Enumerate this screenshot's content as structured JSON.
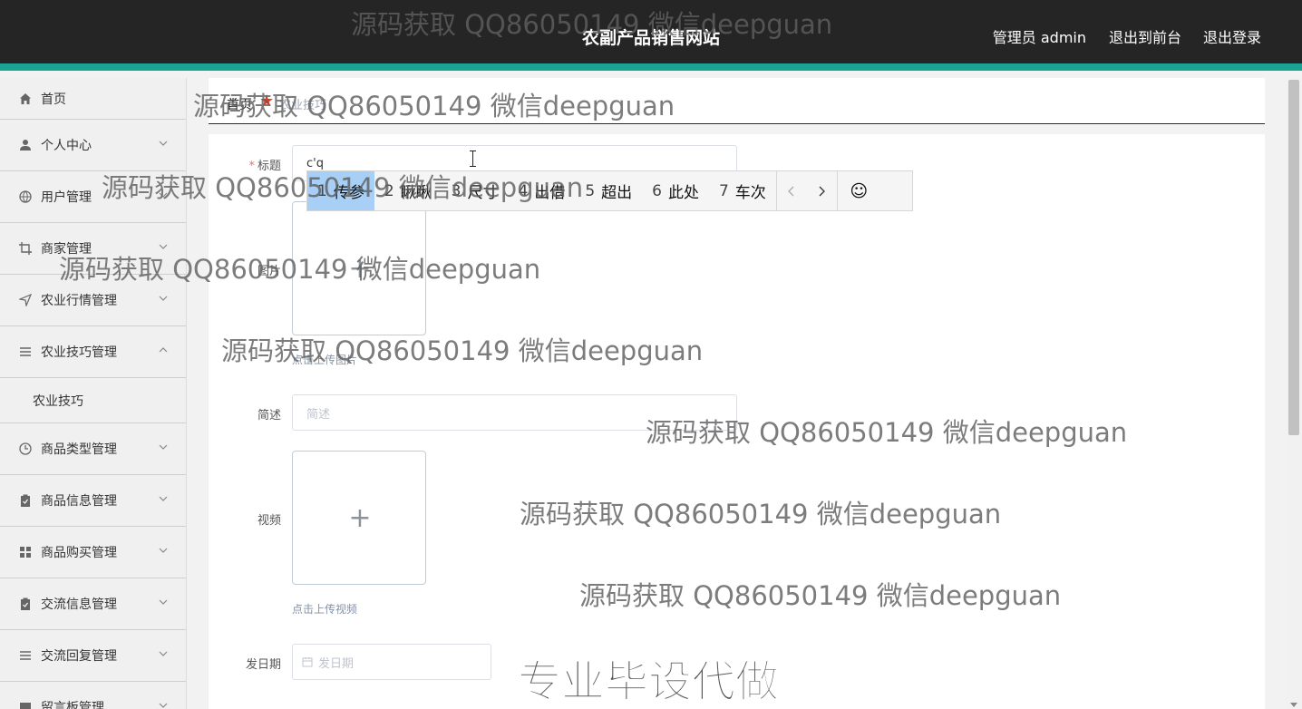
{
  "header": {
    "site_title": "农副产品销售网站",
    "admin_label": "管理员 admin",
    "to_front": "退出到前台",
    "logout": "退出登录"
  },
  "sidebar": {
    "items": [
      {
        "label": "首页",
        "icon": "home-icon"
      },
      {
        "label": "个人中心",
        "icon": "user-icon"
      },
      {
        "label": "用户管理",
        "icon": "globe-icon"
      },
      {
        "label": "商家管理",
        "icon": "crop-icon"
      },
      {
        "label": "农业行情管理",
        "icon": "send-icon"
      },
      {
        "label": "农业技巧管理",
        "icon": "menu-icon"
      },
      {
        "label": "农业技巧",
        "icon": ""
      },
      {
        "label": "商品类型管理",
        "icon": "clock-icon"
      },
      {
        "label": "商品信息管理",
        "icon": "clipboard-icon"
      },
      {
        "label": "商品购买管理",
        "icon": "grid-icon"
      },
      {
        "label": "交流信息管理",
        "icon": "checklist-icon"
      },
      {
        "label": "交流回复管理",
        "icon": "list-icon"
      },
      {
        "label": "留言板管理",
        "icon": "message-icon"
      }
    ]
  },
  "breadcrumb": {
    "home": "首页",
    "current": "农业技巧"
  },
  "form": {
    "title_label": "标题",
    "title_value": "c'q",
    "image_label": "图片",
    "image_hint": "点击上传图片",
    "summary_label": "简述",
    "summary_placeholder": "简述",
    "video_label": "视频",
    "video_hint": "点击上传视频",
    "date_label": "发日期",
    "date_placeholder": "发日期"
  },
  "ime": {
    "candidates": [
      {
        "n": "1",
        "text": "传参"
      },
      {
        "n": "2",
        "text": "瞅瞅"
      },
      {
        "n": "3",
        "text": "尺寸"
      },
      {
        "n": "4",
        "text": "出借"
      },
      {
        "n": "5",
        "text": "超出"
      },
      {
        "n": "6",
        "text": "此处"
      },
      {
        "n": "7",
        "text": "车次"
      }
    ]
  },
  "watermarks": {
    "text": "源码获取 QQ86050149 微信deepguan",
    "big": "专业毕设代做"
  }
}
